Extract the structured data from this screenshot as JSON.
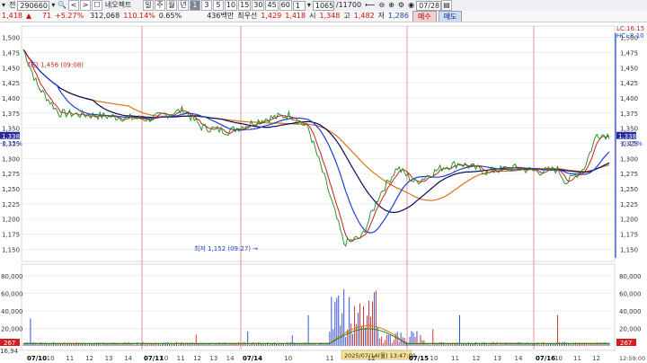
{
  "toolbar": {
    "code": "290660",
    "name": "네오펙트",
    "periods": [
      "일",
      "주",
      "월",
      "년"
    ],
    "active_period": "년",
    "minutes": [
      "1",
      "3",
      "5",
      "10",
      "15",
      "30",
      "45",
      "60"
    ],
    "active_minute": "1",
    "count": "1065",
    "total": "11700",
    "date": "07/28",
    "dropdown_label": "전"
  },
  "quote": {
    "price": "1,418",
    "change": "71",
    "change_pct": "+5.27%",
    "volume": "312,068",
    "volume_ratio": "110.14%",
    "turnover_rate": "0.65%",
    "amount": "436백만",
    "best_ask_label": "최우선",
    "best_ask": "1,429",
    "best_bid": "1,418",
    "open_label": "시",
    "open": "1,348",
    "high_label": "고",
    "high": "1,482",
    "low_label": "저",
    "low": "1,286",
    "buy_label": "매수",
    "sell_label": "매도"
  },
  "price_panel": {
    "y_ticks": [
      "1,500",
      "1,475",
      "1,450",
      "1,425",
      "1,400",
      "1,375",
      "1,350",
      "1,325",
      "1,300",
      "1,275",
      "1,250",
      "1,225",
      "1,200",
      "1,175",
      "1,150"
    ],
    "high_annotation": "최고 1,456 (09:08)",
    "low_annotation": "최저 1,152 (09:27)",
    "lc_label": "LC:16.15",
    "hc_label": "HC:-8.10",
    "current_price": "1,338",
    "left_change": "-0.15%",
    "right_change": "-0.15%"
  },
  "volume_panel": {
    "y_ticks": [
      "80,000",
      "60,000",
      "40,000",
      "20,000"
    ],
    "badge": "267",
    "bottom_value": "16,94"
  },
  "x_axis": {
    "labels": [
      {
        "t": "07/10",
        "day": true
      },
      {
        "t": "10",
        "day": false
      },
      {
        "t": "11",
        "day": false
      },
      {
        "t": "12",
        "day": false
      },
      {
        "t": "13",
        "day": false
      },
      {
        "t": "14",
        "day": false
      },
      {
        "t": "07/11",
        "day": true
      },
      {
        "t": "10",
        "day": false
      },
      {
        "t": "11",
        "day": false
      },
      {
        "t": "12",
        "day": false
      },
      {
        "t": "13",
        "day": false
      },
      {
        "t": "14",
        "day": false
      },
      {
        "t": "07/14",
        "day": true
      },
      {
        "t": "10",
        "day": false
      },
      {
        "t": "11",
        "day": false
      },
      {
        "t": "12",
        "day": false
      },
      {
        "t": "07/15",
        "day": true
      },
      {
        "t": "10",
        "day": false
      },
      {
        "t": "11",
        "day": false
      },
      {
        "t": "12",
        "day": false
      },
      {
        "t": "13",
        "day": false
      },
      {
        "t": "14",
        "day": false
      },
      {
        "t": "07/16",
        "day": true
      },
      {
        "t": "10",
        "day": false
      },
      {
        "t": "11",
        "day": false
      },
      {
        "t": "12",
        "day": false
      }
    ],
    "cursor_time": "2025/07/14(월) 13:47:00",
    "right_time": "12:59:00"
  },
  "chart_data": {
    "type": "line",
    "series_keys": [
      "price",
      "ma_red",
      "ma_blue",
      "ma_orange",
      "ma_navy"
    ],
    "ylim": [
      1140,
      1510
    ],
    "volume_ylim": [
      0,
      90000
    ]
  },
  "colors": {
    "price": "#1a8a1a",
    "ma_red": "#c81e1e",
    "ma_blue": "#1f3fd0",
    "ma_orange": "#d7741a",
    "ma_navy": "#0a0a5a",
    "grid": "#e6e6e6",
    "day_line": "#e0797a",
    "current_badge": "#2a2aa0"
  }
}
